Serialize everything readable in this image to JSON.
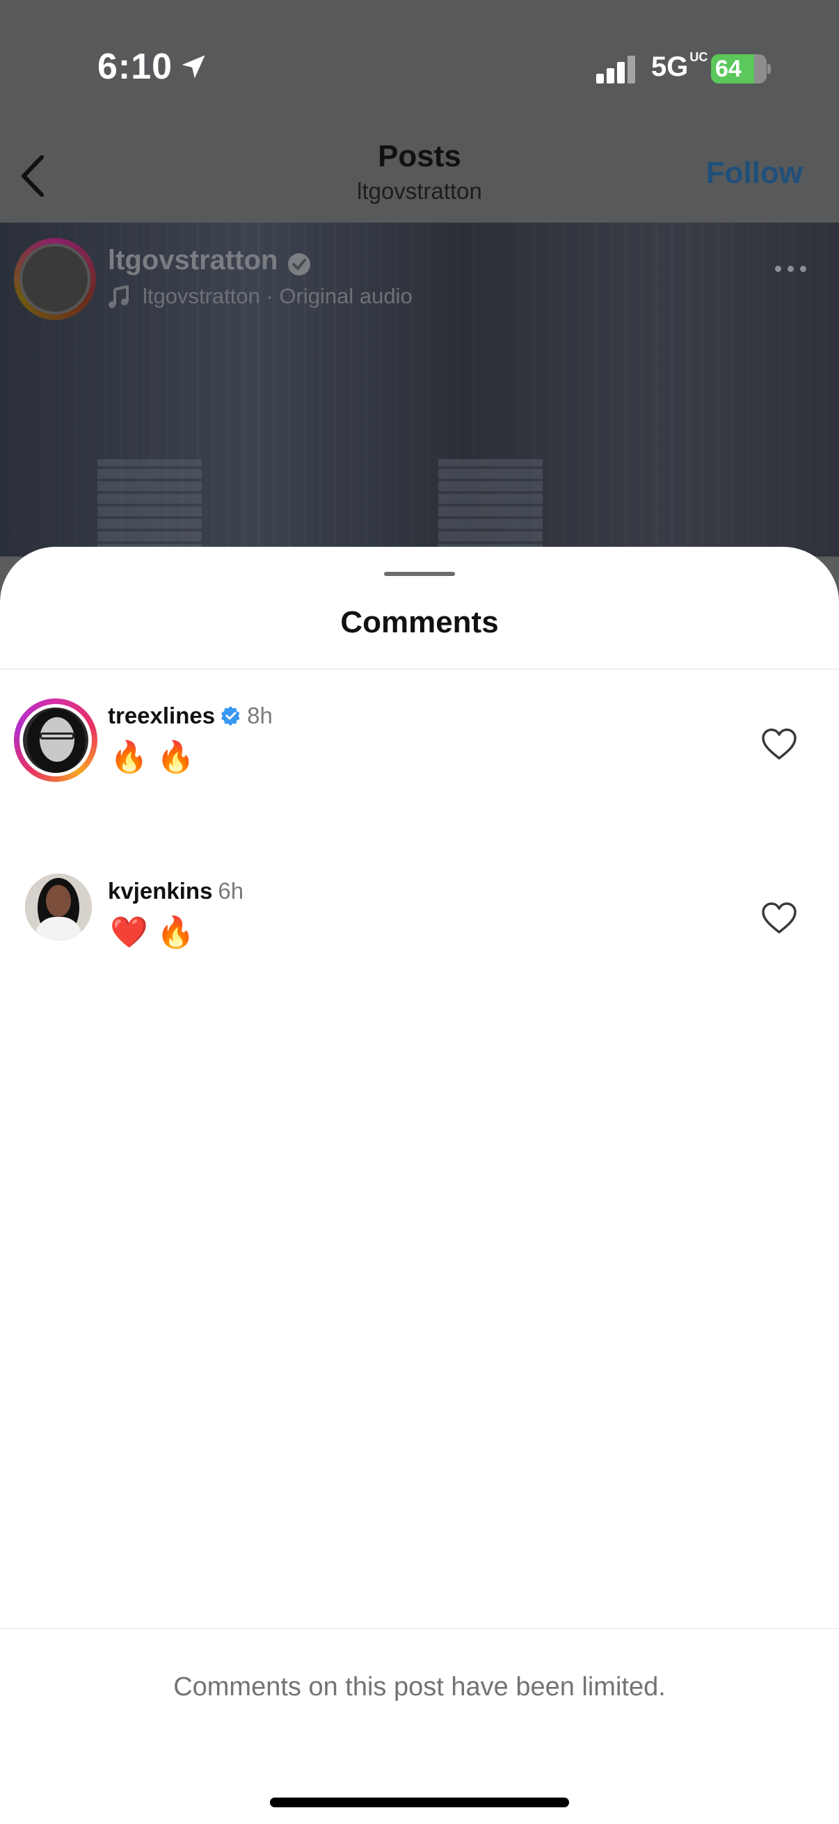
{
  "status_bar": {
    "time": "6:10",
    "network": "5G",
    "network_super": "UC",
    "battery": "64"
  },
  "nav": {
    "title": "Posts",
    "subtitle": "ltgovstratton",
    "follow_label": "Follow"
  },
  "post": {
    "username": "ltgovstratton",
    "audio": "ltgovstratton · Original audio"
  },
  "comments_sheet": {
    "title": "Comments",
    "comments": [
      {
        "username": "treexlines",
        "verified": true,
        "time": "8h",
        "text": "🔥 🔥"
      },
      {
        "username": "kvjenkins",
        "verified": false,
        "time": "6h",
        "text": "❤️ 🔥"
      }
    ],
    "limited_notice": "Comments on this post have been limited."
  },
  "colors": {
    "follow": "#1f4f7a",
    "verified": "#3897f0",
    "muted_text": "#737373"
  }
}
